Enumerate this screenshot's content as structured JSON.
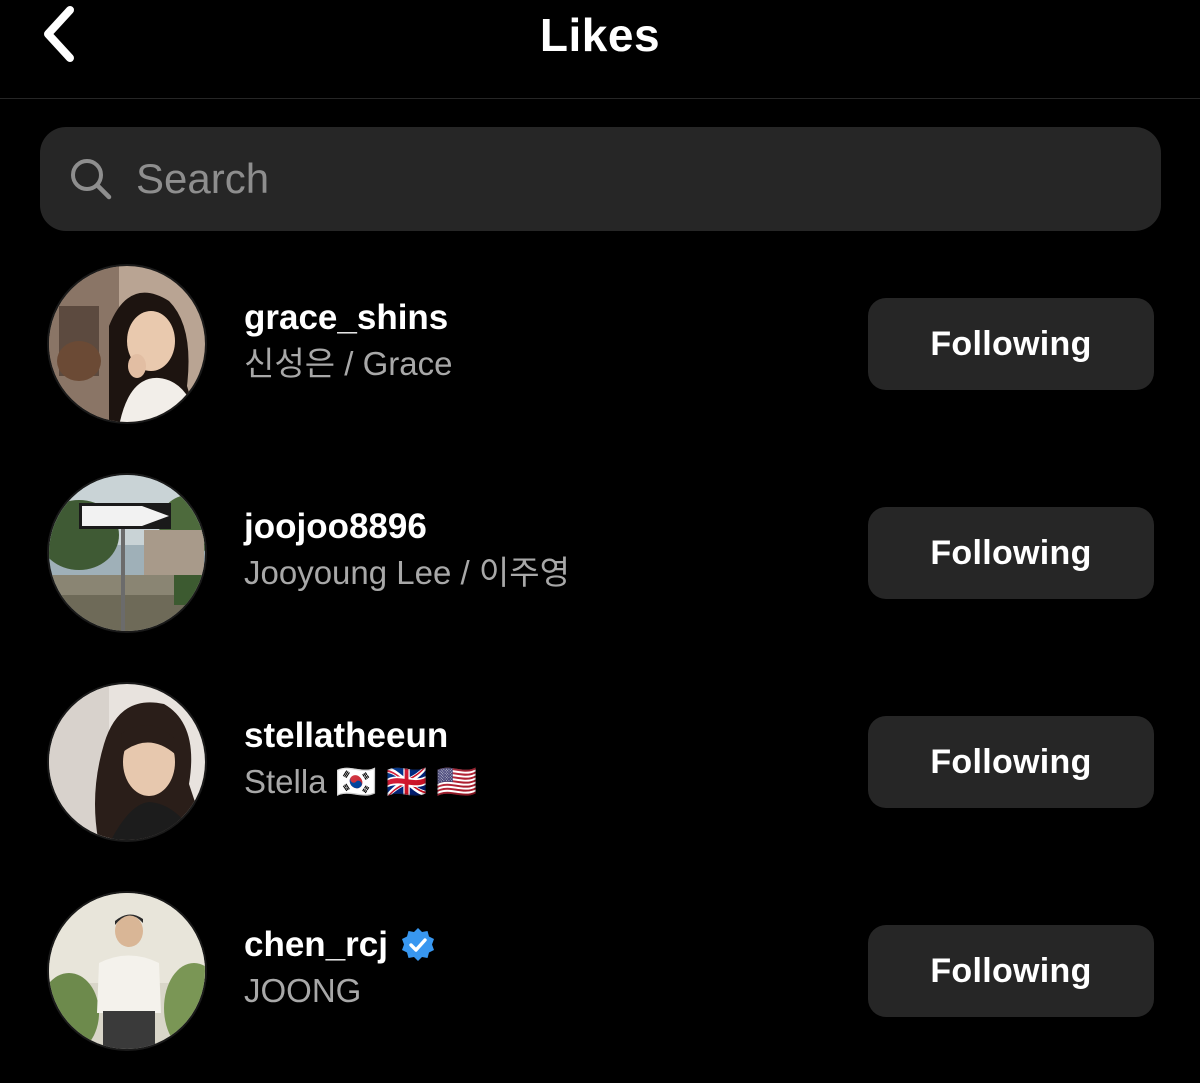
{
  "header": {
    "title": "Likes",
    "back_icon": "chevron-left-icon"
  },
  "search": {
    "placeholder": "Search",
    "value": "",
    "icon": "search-icon"
  },
  "colors": {
    "background": "#000000",
    "surface": "#262626",
    "text_primary": "#ffffff",
    "text_secondary": "#a8a8a8",
    "verified_badge": "#3897f0"
  },
  "likes": [
    {
      "username": "grace_shins",
      "full_name": "신성은 / Grace",
      "verified": false,
      "button_label": "Following"
    },
    {
      "username": "joojoo8896",
      "full_name": "Jooyoung Lee / 이주영",
      "verified": false,
      "button_label": "Following"
    },
    {
      "username": "stellatheeun",
      "full_name": "Stella 🇰🇷 🇬🇧 🇺🇸",
      "verified": false,
      "button_label": "Following"
    },
    {
      "username": "chen_rcj",
      "full_name": "JOONG",
      "verified": true,
      "button_label": "Following"
    }
  ]
}
